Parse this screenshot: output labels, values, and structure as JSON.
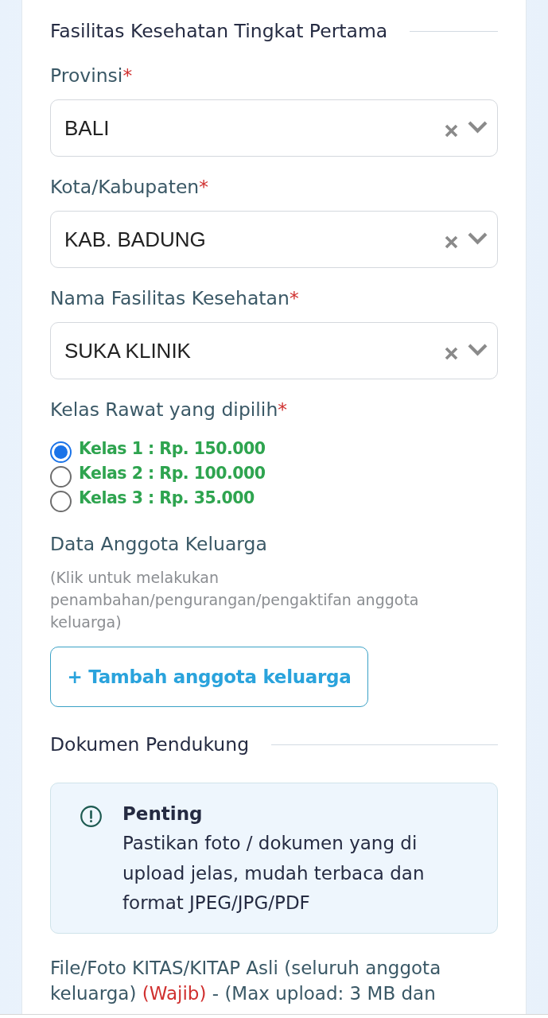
{
  "facility_section": {
    "title": "Fasilitas Kesehatan Tingkat Pertama",
    "fields": [
      {
        "label": "Provinsi",
        "required_mark": "*",
        "value": "BALI"
      },
      {
        "label": "Kota/Kabupaten",
        "required_mark": "*",
        "value": "KAB. BADUNG"
      },
      {
        "label": "Nama Fasilitas Kesehatan",
        "required_mark": "*",
        "value": "SUKA KLINIK"
      }
    ]
  },
  "care_class": {
    "label": "Kelas Rawat yang dipilih",
    "required_mark": "*",
    "options": [
      {
        "label": "Kelas 1 : Rp. 150.000",
        "selected": true
      },
      {
        "label": "Kelas 2 : Rp. 100.000",
        "selected": false
      },
      {
        "label": "Kelas 3 : Rp. 35.000",
        "selected": false
      }
    ]
  },
  "family_members": {
    "title": "Data Anggota Keluarga",
    "hint": "(Klik untuk melakukan penambahan/pengurangan/pengaktifan anggota keluarga)",
    "button": "+ Tambah anggota keluarga"
  },
  "supporting_documents": {
    "title": "Dokumen Pendukung",
    "notice": {
      "title": "Penting",
      "text": "Pastikan foto / dokumen yang di upload jelas, mudah terbaca dan format JPEG/JPG/PDF"
    },
    "upload_label": [
      {
        "kind": "normal",
        "text": "File/Foto KITAS/KITAP Asli (seluruh anggota keluarga)"
      },
      {
        "kind": "required",
        "text": "(Wajib)"
      },
      {
        "kind": "normal",
        "text": "- (Max upload: 3 MB dan"
      }
    ]
  }
}
